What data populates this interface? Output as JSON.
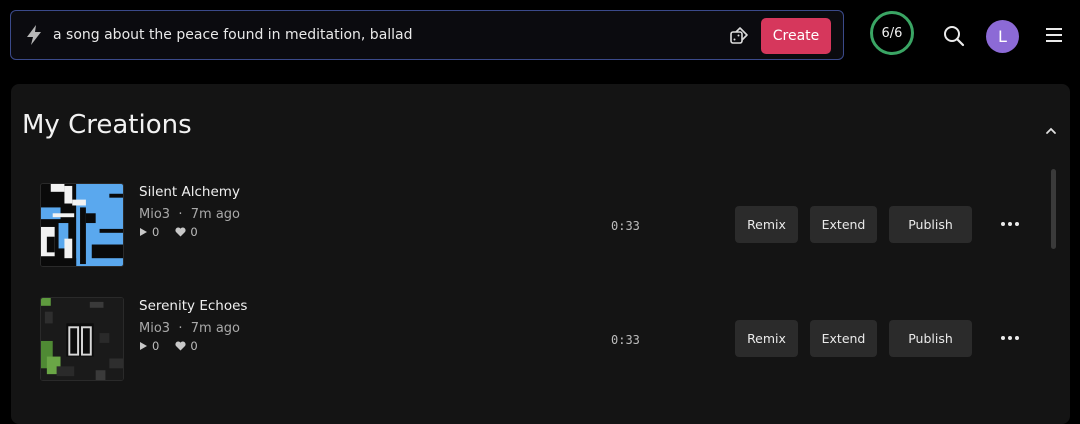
{
  "topbar": {
    "prompt": "a song about the peace found in meditation, ballad",
    "create_label": "Create",
    "credits": "6/6",
    "avatar_initial": "L"
  },
  "section": {
    "title": "My Creations"
  },
  "songs": [
    {
      "title": "Silent Alchemy",
      "artist": "Mio3",
      "time_ago": "7m ago",
      "plays": "0",
      "likes": "0",
      "duration": "0:33",
      "remix_label": "Remix",
      "extend_label": "Extend",
      "publish_label": "Publish"
    },
    {
      "title": "Serenity Echoes",
      "artist": "Mio3",
      "time_ago": "7m ago",
      "plays": "0",
      "likes": "0",
      "duration": "0:33",
      "remix_label": "Remix",
      "extend_label": "Extend",
      "publish_label": "Publish"
    }
  ],
  "icons": {
    "prompt": "lightning-icon",
    "randomize": "dice-icon",
    "search": "search-icon",
    "menu": "hamburger-menu-icon",
    "collapse": "chevron-up-icon",
    "more": "more-options-icon"
  },
  "colors": {
    "accent": "#d6375c",
    "credits_ring": "#3aa564",
    "avatar": "#8c6ad6",
    "prompt_border": "#3b4a8a"
  }
}
